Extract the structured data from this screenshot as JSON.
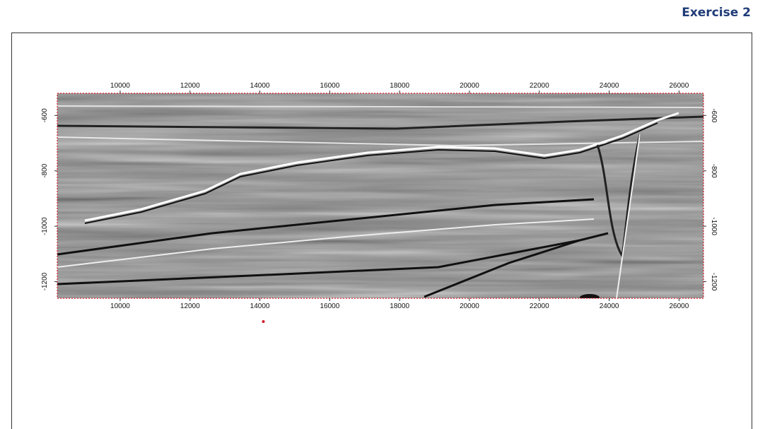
{
  "header": {
    "title": "Exercise 2"
  },
  "colors": {
    "title": "#1f3b78",
    "section_border": "#d21c2a",
    "marker": "#d21c2a"
  },
  "section": {
    "name": "seismic-section",
    "x_ticks": [
      "10000",
      "12000",
      "14000",
      "16000",
      "18000",
      "20000",
      "22000",
      "24000",
      "26000"
    ],
    "y_ticks": [
      "-600",
      "-800",
      "-1000",
      "-1200"
    ],
    "x_range": [
      8200,
      26700
    ],
    "y_range": [
      -520,
      -1260
    ]
  },
  "marker": {
    "x_value": 14100
  }
}
